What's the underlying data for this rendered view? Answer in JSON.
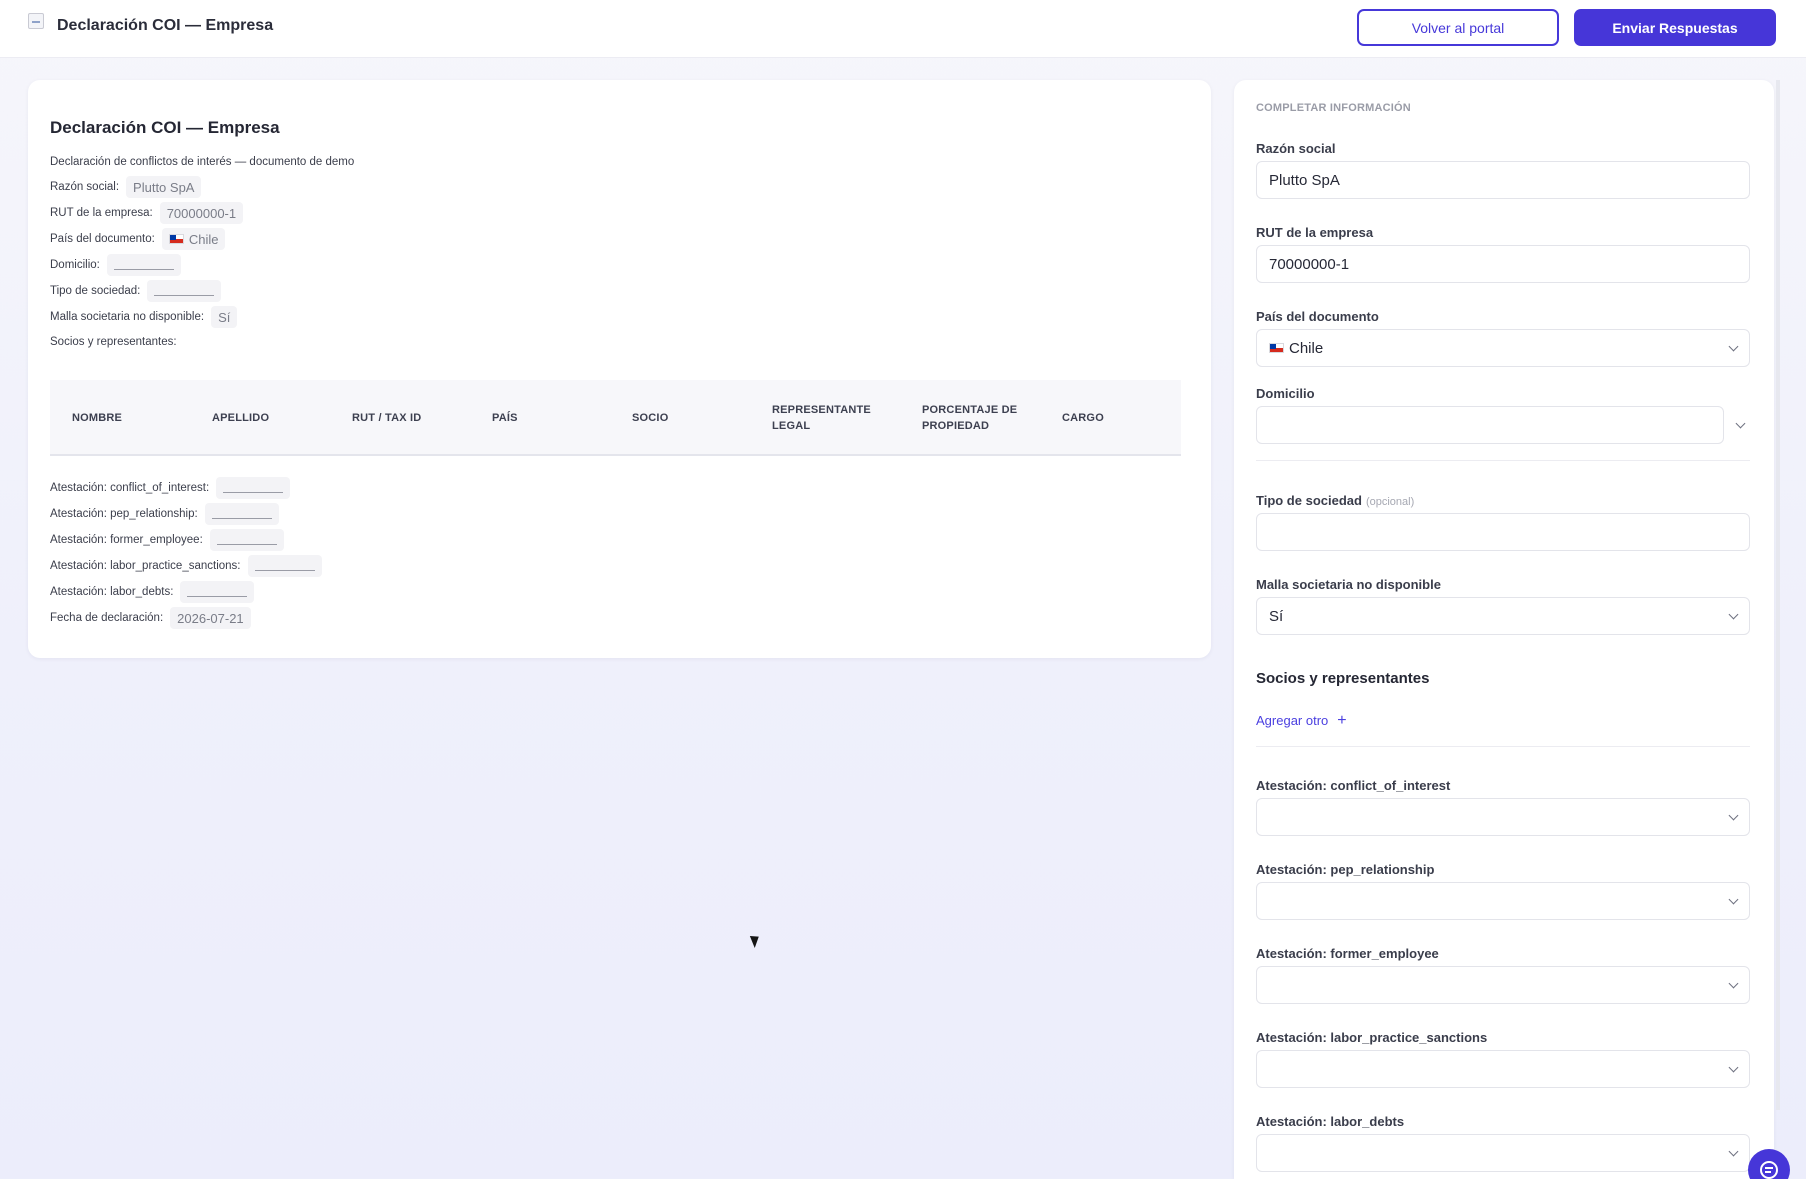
{
  "header": {
    "title": "Declaración COI — Empresa",
    "back_label": "Volver al portal",
    "submit_label": "Enviar Respuestas"
  },
  "preview": {
    "title": "Declaración COI — Empresa",
    "subtitle": "Declaración de conflictos de interés — documento de demo",
    "lines": {
      "razon_label": "Razón social:",
      "razon_value": "Plutto SpA",
      "rut_label": "RUT de la empresa:",
      "rut_value": "70000000-1",
      "pais_label": "País del documento:",
      "pais_value": "Chile",
      "domicilio_label": "Domicilio:",
      "tipo_label": "Tipo de sociedad:",
      "malla_label": "Malla societaria no disponible:",
      "malla_value": "Sí",
      "socios_label": "Socios y representantes:"
    },
    "table_headers": [
      "NOMBRE",
      "APELLIDO",
      "RUT / TAX ID",
      "PAÍS",
      "SOCIO",
      "REPRESENTANTE LEGAL",
      "PORCENTAJE DE PROPIEDAD",
      "CARGO"
    ],
    "attestations": {
      "coi_label": "Atestación: conflict_of_interest:",
      "pep_label": "Atestación: pep_relationship:",
      "former_label": "Atestación: former_employee:",
      "labor_practice_label": "Atestación: labor_practice_sanctions:",
      "labor_debts_label": "Atestación: labor_debts:",
      "fecha_label": "Fecha de declaración:",
      "fecha_value": "2026-07-21"
    }
  },
  "form": {
    "kicker": "COMPLETAR INFORMACIÓN",
    "razon_label": "Razón social",
    "razon_value": "Plutto SpA",
    "rut_label": "RUT de la empresa",
    "rut_value": "70000000-1",
    "pais_label": "País del documento",
    "pais_value": "Chile",
    "domicilio_label": "Domicilio",
    "domicilio_value": "",
    "tipo_label": "Tipo de sociedad",
    "tipo_optional": "(opcional)",
    "tipo_value": "",
    "malla_label": "Malla societaria no disponible",
    "malla_value": "Sí",
    "socios_heading": "Socios y representantes",
    "add_label": "Agregar otro",
    "att_coi_label": "Atestación: conflict_of_interest",
    "att_pep_label": "Atestación: pep_relationship",
    "att_former_label": "Atestación: former_employee",
    "att_labor_practice_label": "Atestación: labor_practice_sanctions",
    "att_labor_debts_label": "Atestación: labor_debts"
  }
}
